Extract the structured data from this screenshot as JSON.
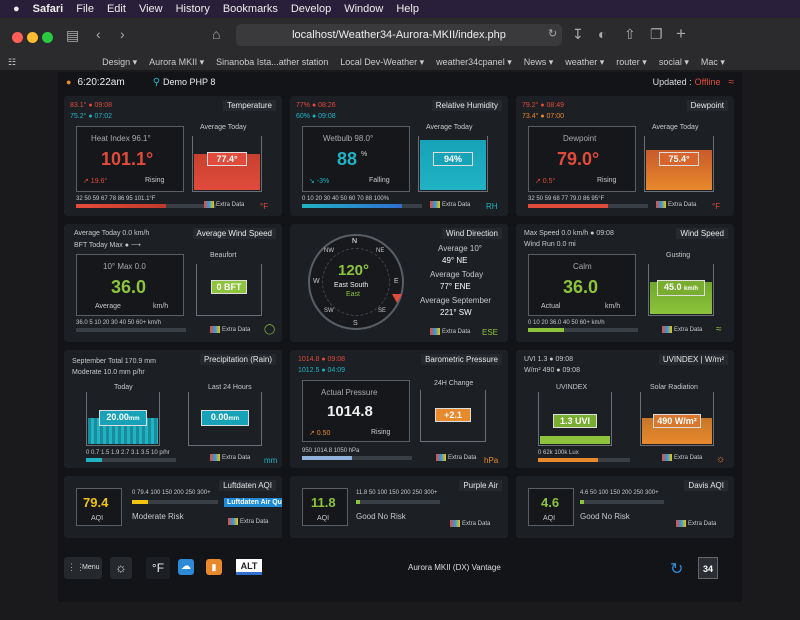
{
  "menubar": {
    "apple": "",
    "app": "Safari",
    "items": [
      "File",
      "Edit",
      "View",
      "History",
      "Bookmarks",
      "Develop",
      "Window",
      "Help"
    ]
  },
  "browser": {
    "url": "localhost/Weather34-Aurora-MKII/index.php",
    "bookmarks": [
      "Design ▾",
      "Aurora MKII ▾",
      "Sinanoba Ista...ather station",
      "Local Dev-Weather ▾",
      "weather34cpanel ▾",
      "News ▾",
      "weather ▾",
      "router ▾",
      "social ▾",
      "Mac ▾"
    ]
  },
  "top": {
    "time": "6:20:22am",
    "demo": "Demo PHP 8",
    "updated_label": "Updated :",
    "status": "Offline"
  },
  "temperature": {
    "title": "Temperature",
    "hi": "83.1° ● 09:08",
    "lo": "75.2° ● 07:02",
    "avg_label": "Average Today",
    "label": "Heat Index 96.1°",
    "value": "101.1°",
    "trend": "↗ 19.6°",
    "state": "Rising",
    "avg": "77.4°",
    "scale": "32 50 59 67 78 86 95 101.1°F",
    "unit": "°F",
    "extra": "Extra Data"
  },
  "humidity": {
    "title": "Relative Humidity",
    "hi": "77% ● 08:26",
    "lo": "60% ● 09:08",
    "avg_label": "Average Today",
    "label": "Wetbulb 98.0°",
    "value": "88",
    "pct": "%",
    "trend": "↘ -3%",
    "state": "Falling",
    "avg": "94%",
    "scale": "0 10 20 30 40 50 60 70 88 100%",
    "unit": "RH",
    "extra": "Extra Data"
  },
  "dewpoint": {
    "title": "Dewpoint",
    "hi": "79.2° ● 08:49",
    "lo": "73.4° ● 07:00",
    "avg_label": "Average Today",
    "label": "Dewpoint",
    "value": "79.0°",
    "trend": "↗ 0.5°",
    "state": "Rising",
    "avg": "75.4°",
    "scale": "32 50 59 68 77 79.0 86 95°F",
    "unit": "°F",
    "extra": "Extra Data"
  },
  "avgwind": {
    "title": "Average Wind Speed",
    "l1": "Average Today 0.0 km/h",
    "l2": "BFT Today Max ● ⟶",
    "beaufort": "Beaufort",
    "label": "10° Max 0.0",
    "value": "36.0",
    "sub": "Average",
    "kmh": "km/h",
    "bft": "0 BFT",
    "scale": "36.0 5 10 20 30 40 50 60+ km/h",
    "extra": "Extra Data"
  },
  "winddir": {
    "title": "Wind Direction",
    "deg": "120°",
    "name": "East South",
    "sub": "East",
    "a1": "Average 10°",
    "v1": "49° NE",
    "a2": "Average Today",
    "v2": "77° ENE",
    "a3": "Average September",
    "v3": "221° SW",
    "unit": "ESE",
    "extra": "Extra Data",
    "compass": [
      "N",
      "NE",
      "E",
      "SE",
      "S",
      "SW",
      "W",
      "NW"
    ]
  },
  "windspeed": {
    "title": "Wind Speed",
    "l1": "Max Speed 0.0 km/h ● 09:08",
    "l2": "Wind Run 0.0 mi",
    "gust_label": "Gusting",
    "label": "Calm",
    "value": "36.0",
    "sub": "Actual",
    "kmh": "km/h",
    "gust": "45.0",
    "gust_unit": "km/h",
    "scale": "0 10 20 36.0 40 50 60+ km/h",
    "extra": "Extra Data"
  },
  "rain": {
    "title": "Precipitation (Rain)",
    "l1": "September Total 170.9 mm",
    "l2": "Moderate 10.0 mm p/hr",
    "today": "Today",
    "last": "Last 24 Hours",
    "v1": "20.00",
    "v2": "0.00",
    "mm": "mm",
    "scale": "0 0.7 1.5 1.9 2.7 3.1 3.5 10 p/hr",
    "extra": "Extra Data",
    "unit": "mm"
  },
  "baro": {
    "title": "Barometric Pressure",
    "hi": "1014.8 ● 09:08",
    "lo": "1012.5 ● 04:09",
    "label": "Actual Pressure",
    "value": "1014.8",
    "trend": "↗ 0.50",
    "state": "Rising",
    "chg_label": "24H Change",
    "chg": "+2.1",
    "scale": "950 1014.8 1050 hPa",
    "unit": "hPa",
    "extra": "Extra Data"
  },
  "uv": {
    "title": "UVINDEX | W/m²",
    "hi": "UVI 1.3 ● 09:08",
    "lo": "W/m² 490 ● 09:08",
    "uv_label": "UVINDEX",
    "sr_label": "Solar Radiation",
    "uv": "1.3 UVI",
    "sr": "490 W/m²",
    "scale": "0 62k 100k Lux",
    "extra": "Extra Data"
  },
  "aqi1": {
    "title": "Luftdaten AQI",
    "value": "79.4",
    "aqi": "AQI",
    "scale": "0 79.4 100 150 200 250 300+",
    "risk": "Moderate Risk",
    "badge": "Luftdaten Air Quality",
    "extra": "Extra Data"
  },
  "aqi2": {
    "title": "Purple Air",
    "value": "11.8",
    "aqi": "AQI",
    "scale": "11.8 50 100 150 200 250 300+",
    "risk": "Good No Risk",
    "extra": "Extra Data"
  },
  "aqi3": {
    "title": "Davis AQI",
    "value": "4.6",
    "aqi": "AQI",
    "scale": "4.6 50 100 150 200 250 300+",
    "risk": "Good No Risk",
    "extra": "Extra Data"
  },
  "footer": {
    "menu": "Menu",
    "unit": "°F",
    "alt": "ALT",
    "station": "Aurora MKII (DX) Vantage",
    "logo": "34"
  },
  "colors": {
    "red": "#e14b3b",
    "teal": "#1fb3c4",
    "green": "#8dc43c",
    "orange": "#e8892c",
    "blue": "#2f6fd0"
  }
}
